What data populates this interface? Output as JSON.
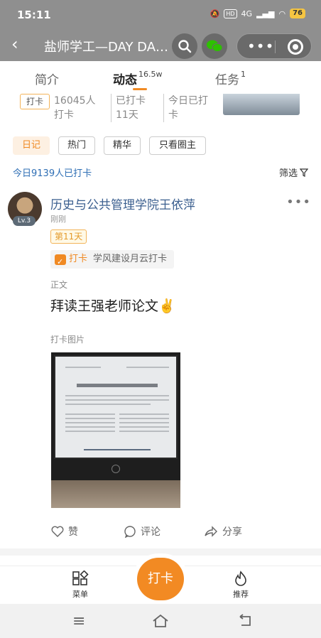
{
  "status_bar": {
    "time": "15:11",
    "network": "4G",
    "battery": "76"
  },
  "navbar": {
    "title": "盐师学工—DAY DA…"
  },
  "tabs": [
    {
      "label": "简介",
      "badge": ""
    },
    {
      "label": "动态",
      "badge": "16.5w"
    },
    {
      "label": "任务",
      "badge": "1"
    }
  ],
  "stats": {
    "tag": "打卡",
    "items": [
      "16045人打卡",
      "已打卡11天",
      "今日已打卡"
    ]
  },
  "chips": [
    "日记",
    "热门",
    "精华",
    "只看圈主"
  ],
  "today_count": "今日9139人已打卡",
  "filter_label": "筛选",
  "post": {
    "author": "历史与公共管理学院王依萍",
    "level": "Lv.3",
    "time": "刚刚",
    "day_badge": "第11天",
    "daka_key": "打卡",
    "daka_value": "学风建设月云打卡",
    "body_label": "正文",
    "body": "拜读王强老师论文✌️",
    "image_label": "打卡图片",
    "photo_title": "1956年后毛泽东\"实践资本主义\"思想初探",
    "actions": {
      "like": "赞",
      "comment": "评论",
      "share": "分享"
    }
  },
  "bottom_bar": {
    "menu": "菜单",
    "daka": "打卡",
    "recommend": "推荐"
  }
}
